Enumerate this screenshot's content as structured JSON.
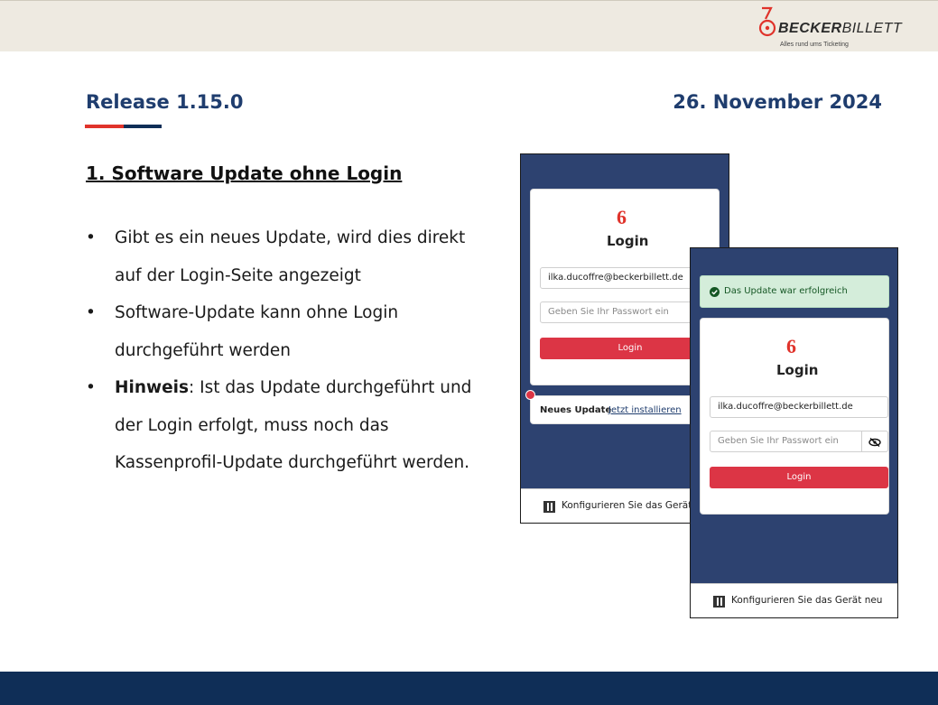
{
  "header": {
    "brand_bold": "BECKER",
    "brand_regular": "BILLETT",
    "tagline": "Alles rund ums Ticketing"
  },
  "slide": {
    "release": "Release 1.15.0",
    "date": "26. November 2024",
    "section_title": "1. Software Update ohne Login",
    "bullets": [
      {
        "text": "Gibt es ein neues Update, wird dies direkt auf der Login-Seite angezeigt"
      },
      {
        "text": "Software-Update kann ohne Login durchgeführt werden"
      },
      {
        "bold": "Hinweis",
        "text": ": Ist das Update durchgeführt und der Login erfolgt, muss noch das Kassenprofil-Update durchgeführt werden."
      }
    ]
  },
  "screen1": {
    "title": "Login",
    "email": "ilka.ducoffre@beckerbillett.de",
    "password_placeholder": "Geben Sie Ihr Passwort ein",
    "login_button": "Login",
    "update_label": "Neues Update",
    "update_link": "Jetzt installieren",
    "configure_text": "Konfigurieren Sie das Gerät"
  },
  "screen2": {
    "alert_text": "Das Update war erfolgreich",
    "title": "Login",
    "email": "ilka.ducoffre@beckerbillett.de",
    "password_placeholder": "Geben Sie Ihr Passwort ein",
    "login_button": "Login",
    "configure_text": "Konfigurieren Sie das Gerät neu"
  },
  "colors": {
    "navy": "#1f3d6e",
    "accent_red": "#e0332b",
    "phone_bg": "#2d4270",
    "button_red": "#dc3545",
    "success_bg": "#d4edda"
  },
  "icons": [
    "becker-logo-icon",
    "check-circle-icon",
    "eye-slash-icon",
    "qr-code-icon"
  ]
}
